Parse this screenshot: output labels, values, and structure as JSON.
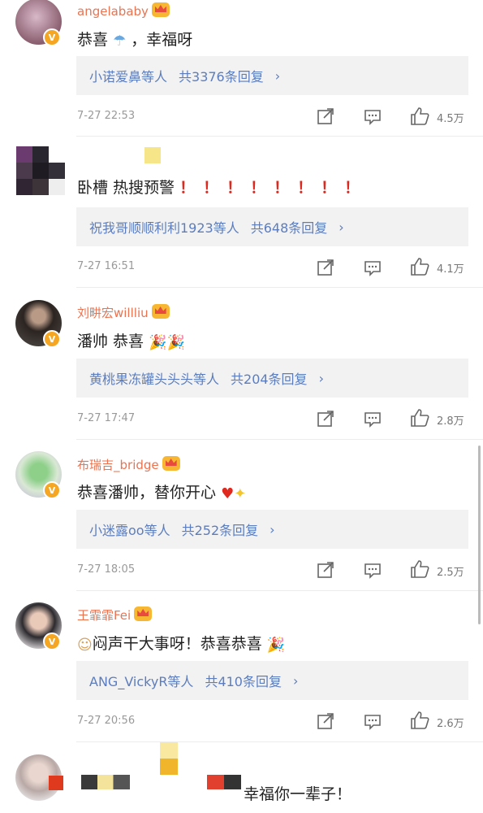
{
  "comments": [
    {
      "user": "angelababy",
      "text": "恭喜",
      "text_tail": "，幸福呀",
      "replies_users": "小诺爱鼻等人",
      "replies_count": "共3376条回复",
      "time": "7-27 22:53",
      "likes": "4.5万"
    },
    {
      "user": "",
      "text": "卧槽 热搜预警",
      "warn_marks": "！！！！！！！！",
      "replies_users": "祝我哥顺顺利利1923等人",
      "replies_count": "共648条回复",
      "time": "7-27 16:51",
      "likes": "4.1万"
    },
    {
      "user": "刘畊宏willliu",
      "text": "潘帅 恭喜",
      "replies_users": "黄桃果冻罐头头头等人",
      "replies_count": "共204条回复",
      "time": "7-27 17:47",
      "likes": "2.8万"
    },
    {
      "user": "布瑞吉_bridge",
      "text": "恭喜潘帅，替你开心",
      "replies_users": "小迷露oo等人",
      "replies_count": "共252条回复",
      "time": "7-27 18:05",
      "likes": "2.5万"
    },
    {
      "user": "王霏霏Fei",
      "text": "闷声干大事呀！恭喜恭喜",
      "replies_users": "ANG_VickyR等人",
      "replies_count": "共410条回复",
      "time": "7-27 20:56",
      "likes": "2.6万"
    },
    {
      "user": "",
      "text": "幸福你一辈子！"
    }
  ],
  "icons": {
    "share": "share-icon",
    "comment": "comment-icon",
    "like": "like-icon",
    "verified": "verified-badge-icon",
    "crown": "crown-icon",
    "chevron": "chevron-right-icon"
  },
  "colors": {
    "username": "#eb7350",
    "reply_link": "#5b7dbf",
    "reply_bg": "#f2f2f2",
    "meta": "#999999",
    "verified": "#f5a623"
  }
}
